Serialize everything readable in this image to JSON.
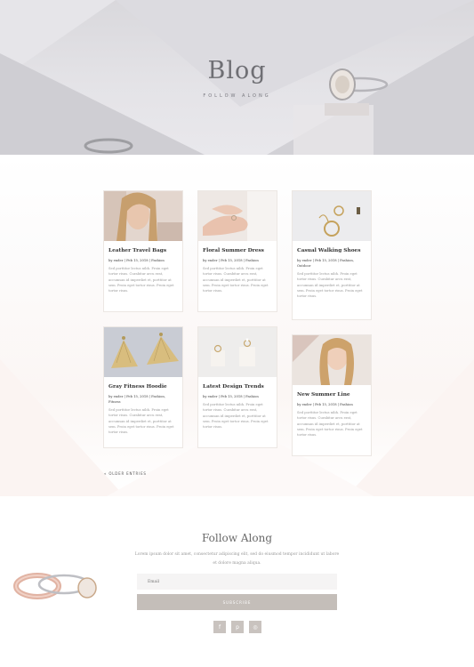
{
  "hero": {
    "title": "Blog",
    "subtitle": "FOLLOW ALONG"
  },
  "posts": [
    {
      "title": "Leather Travel Bags",
      "meta": "by ender | Feb 15, 2018 | Fashion",
      "excerpt": "Sed porttitor lectus nibh. Proin eget tortor risus. Curabitur arcu erat, accumsan id imperdiet et, porttitor at sem. Proin eget tortor risus. Proin eget tortor risus."
    },
    {
      "title": "Floral Summer Dress",
      "meta": "by ender | Feb 15, 2018 | Fashion",
      "excerpt": "Sed porttitor lectus nibh. Proin eget tortor risus. Curabitur arcu erat, accumsan id imperdiet et, porttitor at sem. Proin eget tortor risus. Proin eget tortor risus."
    },
    {
      "title": "Casual Walking Shoes",
      "meta": "by ender | Feb 15, 2018 | Fashion, Outdoor",
      "excerpt": "Sed porttitor lectus nibh. Proin eget tortor risus. Curabitur arcu erat, accumsan id imperdiet et, porttitor at sem. Proin eget tortor risus. Proin eget tortor risus."
    },
    {
      "title": "Gray Fitness Hoodie",
      "meta": "by ender | Feb 15, 2018 | Fashion, Fitness",
      "excerpt": "Sed porttitor lectus nibh. Proin eget tortor risus. Curabitur arcu erat, accumsan id imperdiet et, porttitor at sem. Proin eget tortor risus. Proin eget tortor risus."
    },
    {
      "title": "Latest Design Trends",
      "meta": "by ender | Feb 15, 2018 | Fashion",
      "excerpt": "Sed porttitor lectus nibh. Proin eget tortor risus. Curabitur arcu erat, accumsan id imperdiet et, porttitor at sem. Proin eget tortor risus. Proin eget tortor risus."
    },
    {
      "title": "New Summer Line",
      "meta": "by ender | Feb 15, 2018 | Fashion",
      "excerpt": "Sed porttitor lectus nibh. Proin eget tortor risus. Curabitur arcu erat, accumsan id imperdiet et, porttitor at sem. Proin eget tortor risus. Proin eget tortor risus."
    }
  ],
  "pagination": {
    "older_label": "« OLDER ENTRIES"
  },
  "follow": {
    "title": "Follow Along",
    "text": "Lorem ipsum dolor sit amet, consectetur adipiscing elit, sed do eiusmod tempor incididunt ut labore et dolore magna aliqua.",
    "email_placeholder": "Email",
    "subscribe_label": "SUBSCRIBE"
  },
  "social": [
    {
      "icon": "facebook-icon",
      "glyph": "f"
    },
    {
      "icon": "pinterest-icon",
      "glyph": "p"
    },
    {
      "icon": "instagram-icon",
      "glyph": "◎"
    }
  ],
  "colors": {
    "accent": "#c4beb9",
    "hero_bg": "#e2e1e5",
    "card_border": "#ece7e3"
  }
}
